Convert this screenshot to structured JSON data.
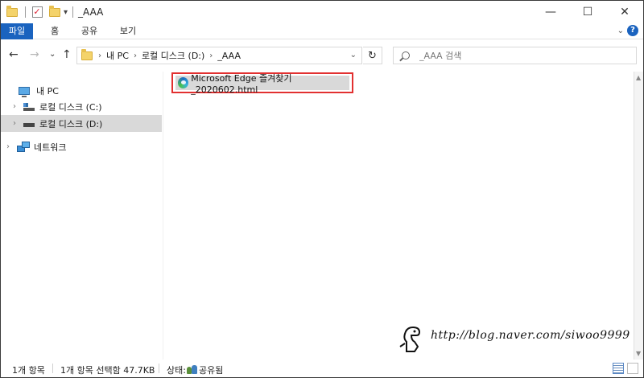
{
  "titlebar": {
    "title": "_AAA",
    "qa_dropdown": "▾",
    "minimize": "—",
    "maximize": "☐",
    "close": "✕"
  },
  "ribbon": {
    "tabs": [
      {
        "label": "파일",
        "active": true
      },
      {
        "label": "홈",
        "active": false
      },
      {
        "label": "공유",
        "active": false
      },
      {
        "label": "보기",
        "active": false
      }
    ],
    "collapse_chevron": "⌄",
    "help": "?"
  },
  "nav_buttons": {
    "back": "←",
    "forward": "→",
    "recent": "⌄",
    "up": "↑"
  },
  "address": {
    "crumbs": [
      "내 PC",
      "로컬 디스크 (D:)",
      "_AAA"
    ],
    "sep": "›",
    "dropdown": "⌄",
    "refresh": "↻"
  },
  "search": {
    "placeholder": "_AAA 검색"
  },
  "nav_pane": {
    "items": [
      {
        "label": "내 PC",
        "expander": "",
        "icon": "pc-icon",
        "selected": false
      },
      {
        "label": "로컬 디스크 (C:)",
        "expander": "›",
        "icon": "drive-c-icon",
        "selected": false
      },
      {
        "label": "로컬 디스크 (D:)",
        "expander": "›",
        "icon": "drive-d-icon",
        "selected": true
      },
      {
        "label": "네트워크",
        "expander": "›",
        "icon": "network-icon",
        "selected": false
      }
    ]
  },
  "content": {
    "files": [
      {
        "name": "Microsoft Edge 즐겨찾기_2020602.html",
        "icon": "edge-icon",
        "selected": true,
        "highlighted": true
      }
    ]
  },
  "status": {
    "count": "1개 항목",
    "selection": "1개 항목 선택함 47.7KB",
    "state_label": "상태:",
    "state_value": "공유됨"
  },
  "scrollbar": {
    "up": "▲",
    "down": "▼"
  },
  "watermark": {
    "text": "http://blog.naver.com/siwoo9999"
  },
  "colors": {
    "accent": "#1a63bf",
    "highlight_border": "#e23030",
    "selection": "#d9d9d9"
  }
}
